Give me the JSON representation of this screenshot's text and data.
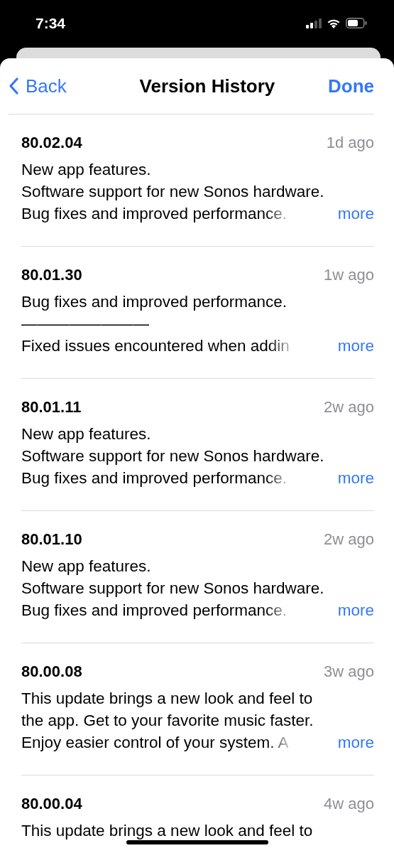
{
  "status_bar": {
    "time": "7:34"
  },
  "nav": {
    "back": "Back",
    "title": "Version History",
    "done": "Done"
  },
  "versions": [
    {
      "version": "80.02.04",
      "date": "1d ago",
      "lines": [
        "New app features.",
        "Software support for new Sonos hardware.",
        "Bug fixes and improved performance."
      ],
      "more": "more"
    },
    {
      "version": "80.01.30",
      "date": "1w ago",
      "lines": [
        "Bug fixes and improved performance.",
        "————————",
        "Fixed issues encountered when addin"
      ],
      "more": "more"
    },
    {
      "version": "80.01.11",
      "date": "2w ago",
      "lines": [
        "New app features.",
        "Software support for new Sonos hardware.",
        "Bug fixes and improved performance."
      ],
      "more": "more"
    },
    {
      "version": "80.01.10",
      "date": "2w ago",
      "lines": [
        "New app features.",
        "Software support for new Sonos hardware.",
        "Bug fixes and improved performance."
      ],
      "more": "more"
    },
    {
      "version": "80.00.08",
      "date": "3w ago",
      "lines": [
        "This update brings a new look and feel to",
        "the app. Get to your favorite music faster.",
        "Enjoy easier control of your system. A"
      ],
      "more": "more"
    },
    {
      "version": "80.00.04",
      "date": "4w ago",
      "lines": [
        "This update brings a new look and feel to"
      ]
    }
  ]
}
